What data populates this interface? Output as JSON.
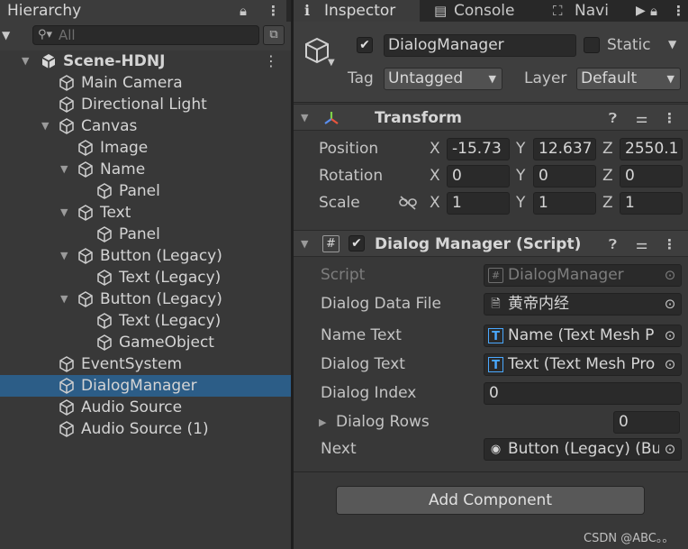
{
  "hierarchy": {
    "tab_label": "Hierarchy",
    "search_placeholder": "All",
    "scene_name": "Scene-HDNJ",
    "items": [
      {
        "label": "Main Camera",
        "depth": 1,
        "expandable": false,
        "selected": false
      },
      {
        "label": "Directional Light",
        "depth": 1,
        "expandable": false,
        "selected": false
      },
      {
        "label": "Canvas",
        "depth": 1,
        "expandable": true,
        "selected": false
      },
      {
        "label": "Image",
        "depth": 2,
        "expandable": false,
        "selected": false
      },
      {
        "label": "Name",
        "depth": 2,
        "expandable": true,
        "selected": false
      },
      {
        "label": "Panel",
        "depth": 3,
        "expandable": false,
        "selected": false
      },
      {
        "label": "Text",
        "depth": 2,
        "expandable": true,
        "selected": false
      },
      {
        "label": "Panel",
        "depth": 3,
        "expandable": false,
        "selected": false
      },
      {
        "label": "Button (Legacy)",
        "depth": 2,
        "expandable": true,
        "selected": false
      },
      {
        "label": "Text (Legacy)",
        "depth": 3,
        "expandable": false,
        "selected": false
      },
      {
        "label": "Button (Legacy)",
        "depth": 2,
        "expandable": true,
        "selected": false
      },
      {
        "label": "Text (Legacy)",
        "depth": 3,
        "expandable": false,
        "selected": false
      },
      {
        "label": "GameObject",
        "depth": 3,
        "expandable": false,
        "selected": false
      },
      {
        "label": "EventSystem",
        "depth": 1,
        "expandable": false,
        "selected": false
      },
      {
        "label": "DialogManager",
        "depth": 1,
        "expandable": false,
        "selected": true
      },
      {
        "label": "Audio Source",
        "depth": 1,
        "expandable": false,
        "selected": false
      },
      {
        "label": "Audio Source (1)",
        "depth": 1,
        "expandable": false,
        "selected": false
      }
    ]
  },
  "inspector": {
    "tabs": {
      "inspector": "Inspector",
      "console": "Console",
      "navigation": "Navi"
    },
    "gameobject": {
      "name": "DialogManager",
      "active": true,
      "static_label": "Static",
      "static": false,
      "tag_label": "Tag",
      "tag_value": "Untagged",
      "layer_label": "Layer",
      "layer_value": "Default"
    },
    "transform": {
      "title": "Transform",
      "position_label": "Position",
      "rotation_label": "Rotation",
      "scale_label": "Scale",
      "axis_x": "X",
      "axis_y": "Y",
      "axis_z": "Z",
      "position": {
        "x": "-15.73",
        "y": "12.637",
        "z": "2550.1"
      },
      "rotation": {
        "x": "0",
        "y": "0",
        "z": "0"
      },
      "scale": {
        "x": "1",
        "y": "1",
        "z": "1"
      }
    },
    "script_component": {
      "title": "Dialog Manager (Script)",
      "enabled": true,
      "script_label": "Script",
      "script_value": "DialogManager",
      "dialog_data_file_label": "Dialog Data File",
      "dialog_data_file_value": "黄帝内经",
      "name_text_label": "Name Text",
      "name_text_value": "Name (Text Mesh P",
      "dialog_text_label": "Dialog Text",
      "dialog_text_value": "Text (Text Mesh Pro",
      "dialog_index_label": "Dialog Index",
      "dialog_index_value": "0",
      "dialog_rows_label": "Dialog Rows",
      "dialog_rows_value": "0",
      "next_label": "Next",
      "next_value": "Button (Legacy) (Bu"
    },
    "add_component_label": "Add Component"
  },
  "watermark": "CSDN @ABC。。",
  "colors": {
    "selection": "#2c5d87",
    "panel_bg": "#383838",
    "field_bg": "#2a2a2a",
    "tab_bar": "#282828"
  }
}
